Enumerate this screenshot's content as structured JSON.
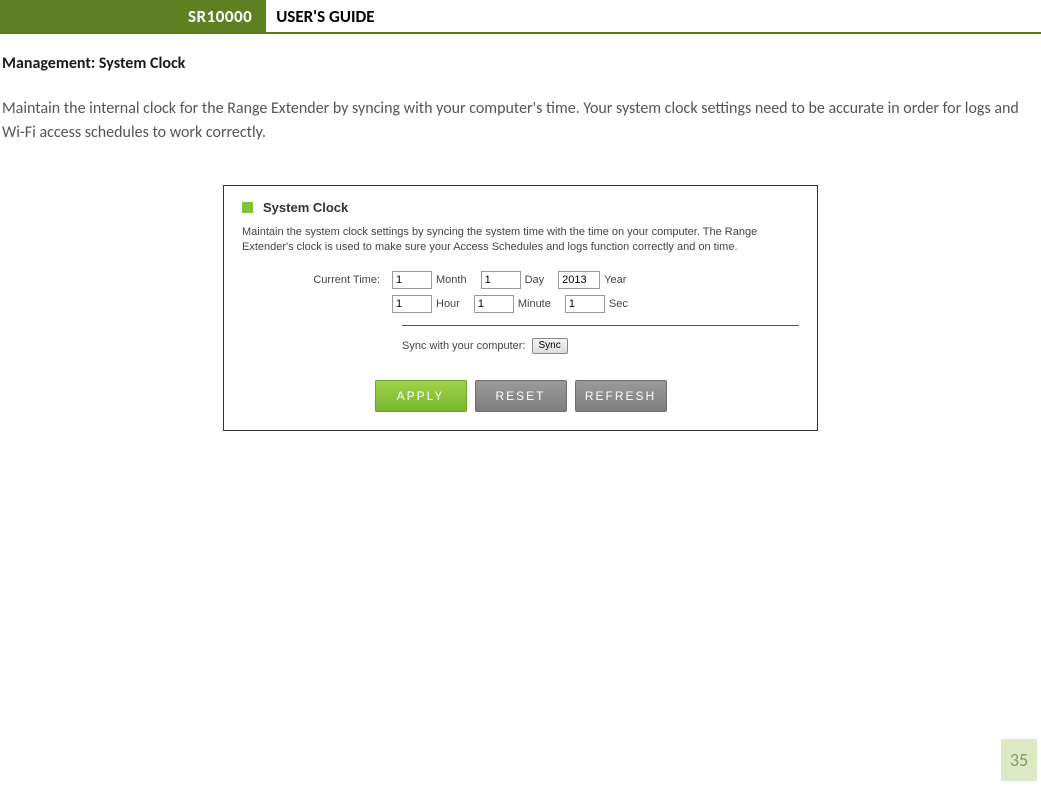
{
  "header": {
    "product": "SR10000",
    "title": "USER'S GUIDE"
  },
  "section_title": "Management: System Clock",
  "intro_text": "Maintain the internal clock for the Range Extender by syncing with your computer's time. Your system clock settings need to be accurate in order for logs and Wi-Fi access schedules to work correctly.",
  "panel": {
    "title": "System Clock",
    "description": "Maintain the system clock settings by syncing the system time with the time on your computer. The Range Extender's clock is used to make sure your Access Schedules and logs function correctly and on time.",
    "current_time_label": "Current Time:",
    "fields": {
      "month": {
        "value": "1",
        "label": "Month"
      },
      "day": {
        "value": "1",
        "label": "Day"
      },
      "year": {
        "value": "2013",
        "label": "Year"
      },
      "hour": {
        "value": "1",
        "label": "Hour"
      },
      "minute": {
        "value": "1",
        "label": "Minute"
      },
      "sec": {
        "value": "1",
        "label": "Sec"
      }
    },
    "sync_label": "Sync with your computer:",
    "sync_button": "Sync",
    "buttons": {
      "apply": "APPLY",
      "reset": "RESET",
      "refresh": "REFRESH"
    }
  },
  "page_number": "35"
}
